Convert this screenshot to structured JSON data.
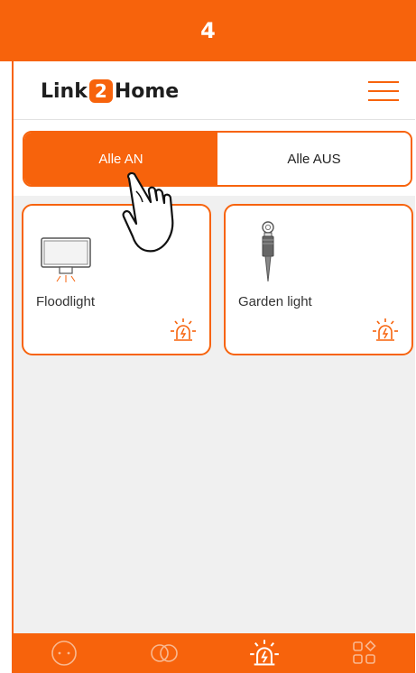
{
  "step": "4",
  "app": {
    "brand_left": "Link",
    "brand_num": "2",
    "brand_right": "Home"
  },
  "toggle": {
    "on_label": "Alle AN",
    "off_label": "Alle AUS"
  },
  "devices": [
    {
      "name": "Floodlight",
      "icon": "floodlight-icon"
    },
    {
      "name": "Garden light",
      "icon": "garden-light-icon"
    }
  ],
  "tabs": [
    "face-icon",
    "link-icon",
    "alarm-icon",
    "apps-icon"
  ],
  "colors": {
    "accent": "#f7630c",
    "background": "#f0f0f0"
  }
}
